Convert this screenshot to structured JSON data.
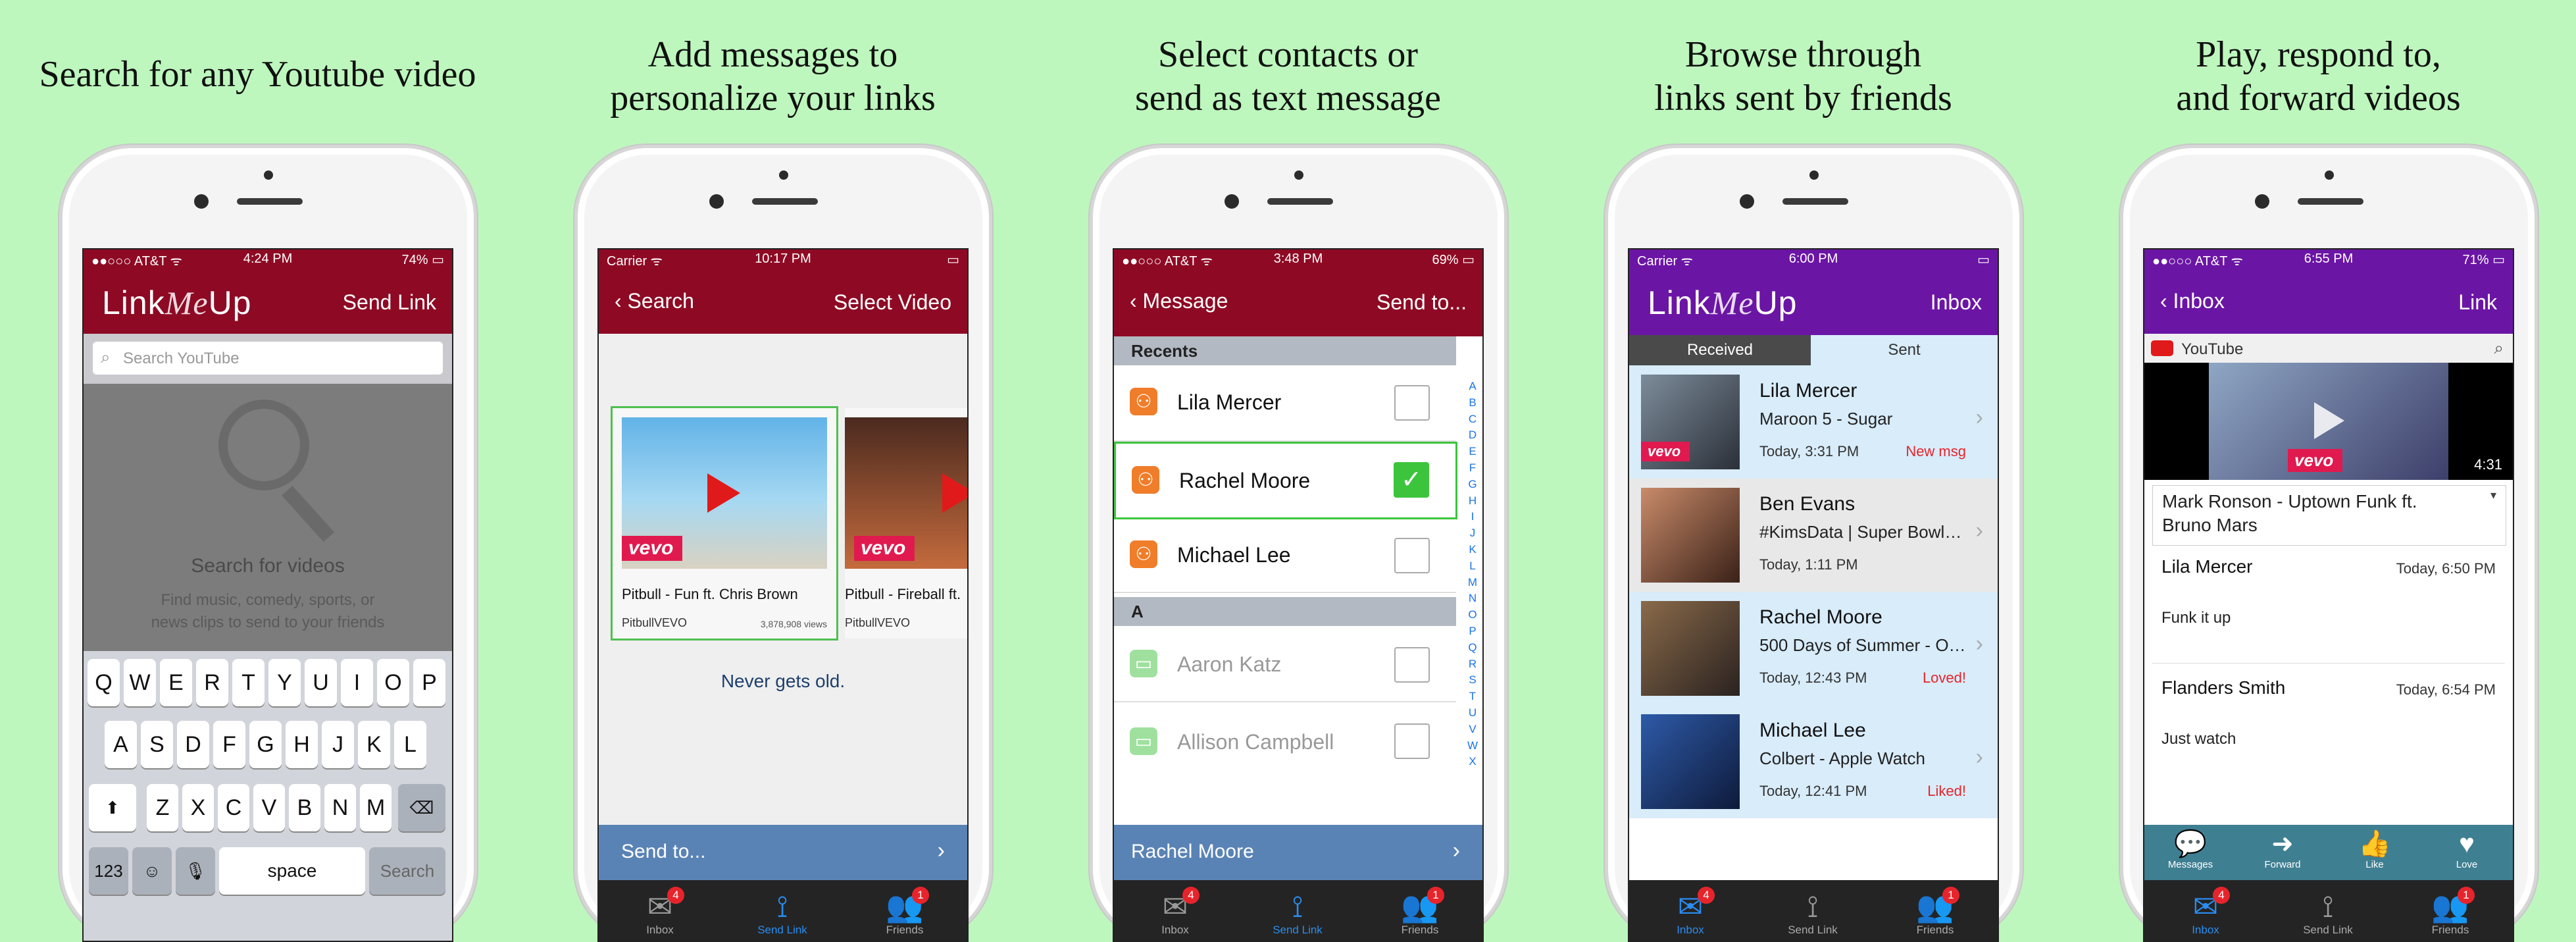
{
  "panels": [
    {
      "caption": [
        "Search for any Youtube video"
      ],
      "status": {
        "carrier": "●●○○○ AT&T ᯤ",
        "time": "4:24 PM",
        "battery": "74% ▭"
      },
      "nav": {
        "logo_a": "Link",
        "logo_b": "Me",
        "logo_c": "Up",
        "right": "Send Link"
      },
      "search_placeholder": "Search YouTube",
      "empty_title": "Search for videos",
      "empty_sub": [
        "Find music, comedy, sports, or",
        "news clips to send to your friends"
      ],
      "keyboard": {
        "row1": [
          "Q",
          "W",
          "E",
          "R",
          "T",
          "Y",
          "U",
          "I",
          "O",
          "P"
        ],
        "row2": [
          "A",
          "S",
          "D",
          "F",
          "G",
          "H",
          "J",
          "K",
          "L"
        ],
        "row3": [
          "Z",
          "X",
          "C",
          "V",
          "B",
          "N",
          "M"
        ],
        "num": "123",
        "space": "space",
        "search": "Search"
      }
    },
    {
      "caption": [
        "Add messages to",
        "personalize your links"
      ],
      "status": {
        "carrier": "Carrier ᯤ",
        "time": "10:17 PM",
        "battery": "▭"
      },
      "nav": {
        "left": "Search",
        "right": "Select Video"
      },
      "videos": [
        {
          "title": "Pitbull - Fun ft. Chris Brown",
          "channel": "PitbullVEVO",
          "views": "3,878,908 views",
          "brand": "vevo"
        },
        {
          "title": "Pitbull - Fireball ft.",
          "channel": "PitbullVEVO",
          "views": "",
          "brand": "vevo"
        }
      ],
      "message": "Never gets old.",
      "send_to": "Send to...",
      "tabs": [
        {
          "label": "Inbox",
          "badge": "4"
        },
        {
          "label": "Send Link",
          "badge": ""
        },
        {
          "label": "Friends",
          "badge": "1"
        }
      ]
    },
    {
      "caption": [
        "Select contacts or",
        "send as text message"
      ],
      "status": {
        "carrier": "●●○○○ AT&T ᯤ",
        "time": "3:48 PM",
        "battery": "69% ▭"
      },
      "nav": {
        "left": "Message",
        "right": "Send to..."
      },
      "sections": [
        {
          "header": "Recents",
          "contacts": [
            {
              "name": "Lila Mercer",
              "checked": false,
              "type": "app"
            },
            {
              "name": "Rachel Moore",
              "checked": true,
              "type": "app"
            },
            {
              "name": "Michael Lee",
              "checked": false,
              "type": "app"
            }
          ]
        },
        {
          "header": "A",
          "contacts": [
            {
              "name": "Aaron Katz",
              "checked": false,
              "type": "sms"
            },
            {
              "name": "Allison Campbell",
              "checked": false,
              "type": "sms"
            }
          ]
        }
      ],
      "alphabet": [
        "A",
        "B",
        "C",
        "D",
        "E",
        "F",
        "G",
        "H",
        "I",
        "J",
        "K",
        "L",
        "M",
        "N",
        "O",
        "P",
        "Q",
        "R",
        "S",
        "T",
        "U",
        "V",
        "W",
        "X"
      ],
      "selected_bar": "Rachel Moore",
      "tabs": [
        {
          "label": "Inbox",
          "badge": "4"
        },
        {
          "label": "Send Link",
          "badge": ""
        },
        {
          "label": "Friends",
          "badge": "1"
        }
      ]
    },
    {
      "caption": [
        "Browse through",
        "links sent by friends"
      ],
      "status": {
        "carrier": "Carrier ᯤ",
        "time": "6:00 PM",
        "battery": "▭"
      },
      "nav": {
        "logo_a": "Link",
        "logo_b": "Me",
        "logo_c": "Up",
        "right": "Inbox"
      },
      "segments": [
        "Received",
        "Sent"
      ],
      "items": [
        {
          "name": "Lila Mercer",
          "song": "Maroon 5 - Sugar",
          "time": "Today, 3:31 PM",
          "status": "New msg",
          "brand": "vevo"
        },
        {
          "name": "Ben Evans",
          "song": "#KimsData | Super Bowl…",
          "time": "Today, 1:11 PM",
          "status": "",
          "brand": ""
        },
        {
          "name": "Rachel Moore",
          "song": "500 Days of Summer - O…",
          "time": "Today, 12:43 PM",
          "status": "Loved!",
          "brand": ""
        },
        {
          "name": "Michael Lee",
          "song": "Colbert - Apple Watch",
          "time": "Today, 12:41 PM",
          "status": "Liked!",
          "brand": ""
        }
      ],
      "tabs": [
        {
          "label": "Inbox",
          "badge": "4"
        },
        {
          "label": "Send Link",
          "badge": ""
        },
        {
          "label": "Friends",
          "badge": "1"
        }
      ]
    },
    {
      "caption": [
        "Play, respond to,",
        "and forward videos"
      ],
      "status": {
        "carrier": "●●○○○ AT&T ᯤ",
        "time": "6:55 PM",
        "battery": "71% ▭"
      },
      "nav": {
        "left": "Inbox",
        "right": "Link"
      },
      "yt_label": "YouTube",
      "video_duration": "4:31",
      "video_brand": "vevo",
      "video_title": [
        "Mark Ronson - Uptown Funk ft.",
        "Bruno Mars"
      ],
      "messages": [
        {
          "name": "Lila Mercer",
          "time": "Today, 6:50 PM",
          "text": "Funk it up"
        },
        {
          "name": "Flanders Smith",
          "time": "Today, 6:54 PM",
          "text": "Just watch"
        }
      ],
      "actions": [
        "Messages",
        "Forward",
        "Like",
        "Love"
      ],
      "tabs": [
        {
          "label": "Inbox",
          "badge": "4"
        },
        {
          "label": "Send Link",
          "badge": ""
        },
        {
          "label": "Friends",
          "badge": "1"
        }
      ]
    }
  ],
  "colors": {
    "bg": "#bdf7bd",
    "red_nav": "#8e0a24",
    "purple_nav": "#6b15a5",
    "tab_active": "#2a8df0",
    "badge": "#e7242b",
    "vevo": "#e01a4f"
  },
  "icons": {
    "search": "magnifier-icon",
    "back": "chevron-left-icon",
    "check": "checkmark-icon",
    "inbox": "envelope-icon",
    "send": "antenna-icon",
    "friends": "people-icon"
  }
}
